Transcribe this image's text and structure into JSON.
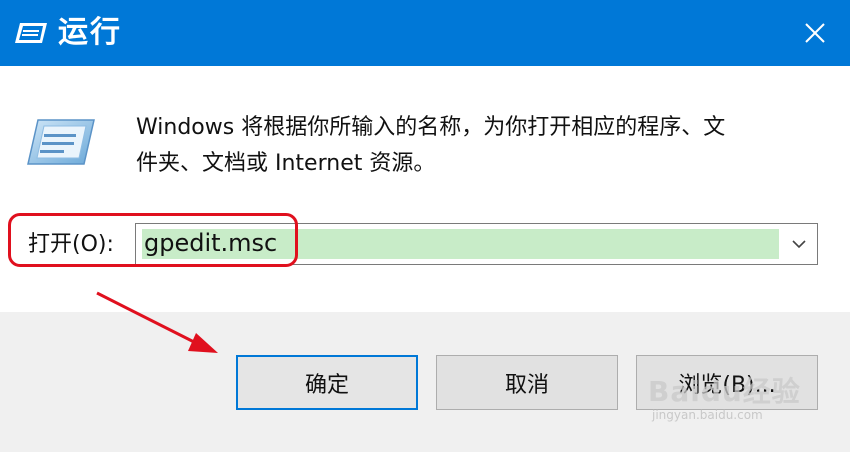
{
  "window": {
    "title": "运行"
  },
  "icons": {
    "app": "run-app-icon",
    "close": "close-icon",
    "run_large": "run-dialog-icon",
    "dropdown": "chevron-down-icon"
  },
  "description": {
    "line1": "Windows 将根据你所输入的名称，为你打开相应的程序、文",
    "line2": "件夹、文档或 Internet 资源。"
  },
  "open_field": {
    "label": "打开(O):",
    "value": "gpedit.msc"
  },
  "buttons": {
    "ok": "确定",
    "cancel": "取消",
    "browse": "浏览(B)..."
  },
  "watermark": {
    "logo": "Baidu经验",
    "url": "jingyan.baidu.com"
  },
  "colors": {
    "titlebar": "#0078d7",
    "highlight": "#e0101e",
    "selection": "#c8ecc8"
  }
}
